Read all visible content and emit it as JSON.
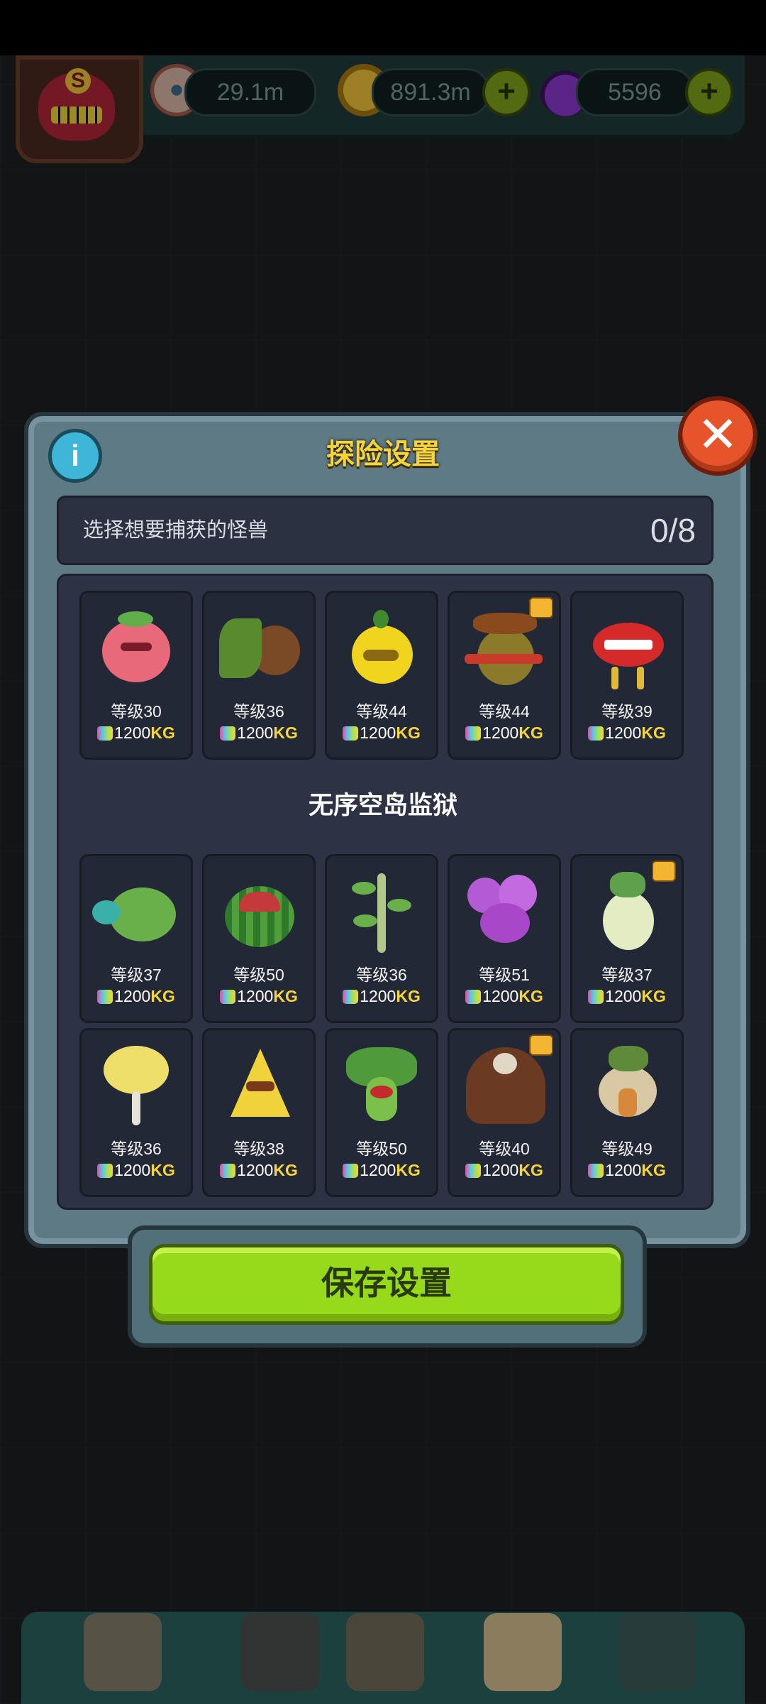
{
  "resources": {
    "eyes": "29.1m",
    "coins": "891.3m",
    "potions": "5596",
    "plus_symbol": "+"
  },
  "player": {
    "rank_letter": "S"
  },
  "dialog": {
    "title": "探险设置",
    "info_symbol": "i",
    "close_symbol": "✕",
    "selection_label": "选择想要捕获的怪兽",
    "selection_count": "0/8",
    "section_title": "无序空岛监狱",
    "save_label": "保存设置"
  },
  "monsters_top": [
    {
      "level": "等级30",
      "weight_num": "1200",
      "weight_unit": "KG",
      "icon": "peach-monster-icon",
      "badge": false
    },
    {
      "level": "等级36",
      "weight_num": "1200",
      "weight_unit": "KG",
      "icon": "coconut-crab-monster-icon",
      "badge": false
    },
    {
      "level": "等级44",
      "weight_num": "1200",
      "weight_unit": "KG",
      "icon": "pear-duck-monster-icon",
      "badge": false
    },
    {
      "level": "等级44",
      "weight_num": "1200",
      "weight_unit": "KG",
      "icon": "cowboy-kiwi-monster-icon",
      "badge": true
    },
    {
      "level": "等级39",
      "weight_num": "1200",
      "weight_unit": "KG",
      "icon": "lips-monster-icon",
      "badge": false
    }
  ],
  "monsters_prison": [
    {
      "level": "等级37",
      "weight_num": "1200",
      "weight_unit": "KG",
      "icon": "cabbage-turtle-monster-icon",
      "badge": false
    },
    {
      "level": "等级50",
      "weight_num": "1200",
      "weight_unit": "KG",
      "icon": "watermelon-monster-icon",
      "badge": false
    },
    {
      "level": "等级36",
      "weight_num": "1200",
      "weight_unit": "KG",
      "icon": "twig-monster-icon",
      "badge": false
    },
    {
      "level": "等级51",
      "weight_num": "1200",
      "weight_unit": "KG",
      "icon": "grape-spider-monster-icon",
      "badge": false
    },
    {
      "level": "等级37",
      "weight_num": "1200",
      "weight_unit": "KG",
      "icon": "radish-monster-icon",
      "badge": true
    },
    {
      "level": "等级36",
      "weight_num": "1200",
      "weight_unit": "KG",
      "icon": "cauliflower-monster-icon",
      "badge": false
    },
    {
      "level": "等级38",
      "weight_num": "1200",
      "weight_unit": "KG",
      "icon": "cheese-monster-icon",
      "badge": false
    },
    {
      "level": "等级50",
      "weight_num": "1200",
      "weight_unit": "KG",
      "icon": "medusa-worm-monster-icon",
      "badge": false
    },
    {
      "level": "等级40",
      "weight_num": "1200",
      "weight_unit": "KG",
      "icon": "hairy-monster-icon",
      "badge": true
    },
    {
      "level": "等级49",
      "weight_num": "1200",
      "weight_unit": "KG",
      "icon": "onion-monster-icon",
      "badge": false
    }
  ],
  "bottom_nav": [
    {
      "icon": "shop-building-icon"
    },
    {
      "icon": "dungeon-gate-icon"
    },
    {
      "icon": "book-icon"
    },
    {
      "icon": "money-bag-icon"
    },
    {
      "icon": "grid-menu-icon"
    }
  ],
  "colors": {
    "accent_yellow": "#f6d43b",
    "save_green": "#97da1c",
    "close_orange": "#e5542a",
    "info_blue": "#3fb6d8"
  }
}
